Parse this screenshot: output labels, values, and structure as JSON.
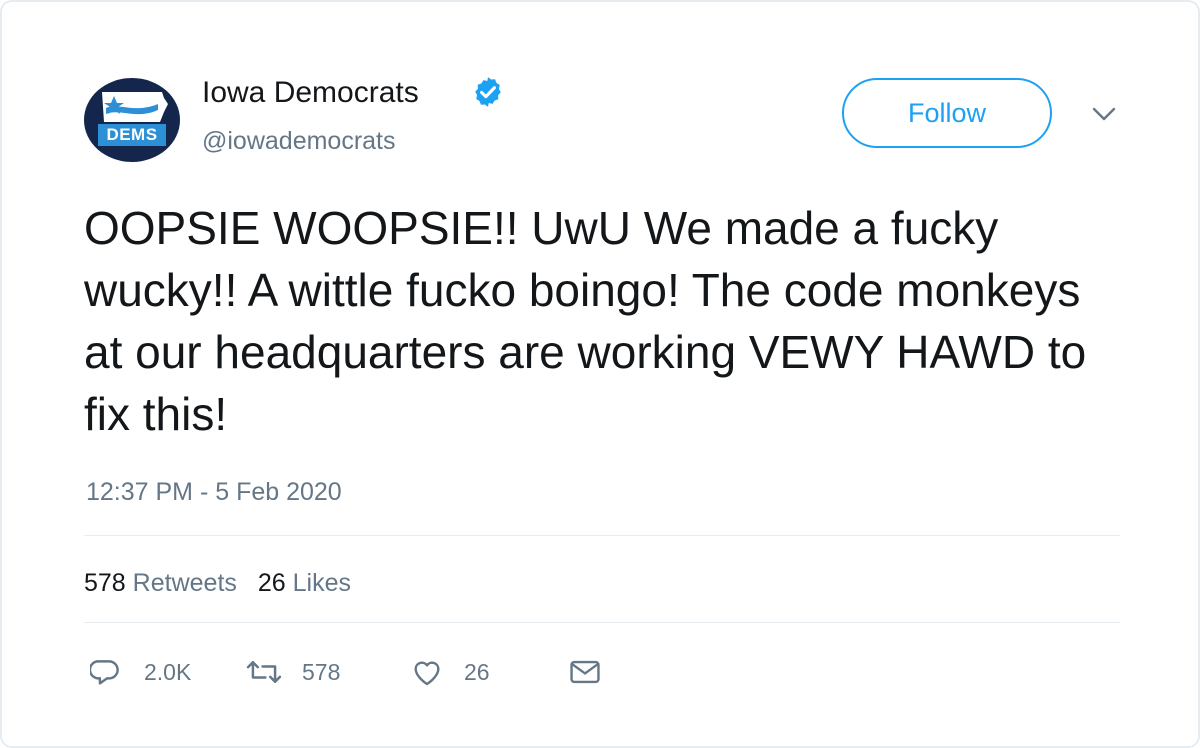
{
  "colors": {
    "accent": "#1da1f2",
    "secondary_text": "#657786",
    "primary_text": "#14171a",
    "avatar_bg": "#15264d",
    "avatar_badge": "#2d8fd5",
    "divider": "#e6ecf0"
  },
  "author": {
    "name": "Iowa Democrats",
    "handle": "@iowademocrats",
    "verified": true,
    "verified_icon": "verified-badge-icon",
    "avatar_badge_text": "DEMS"
  },
  "follow_label": "Follow",
  "menu_icon": "chevron-down-icon",
  "tweet": {
    "text": "OOPSIE WOOPSIE!! UwU We made a fucky wucky!! A wittle fucko boingo! The code monkeys at our headquarters are working VEWY HAWD to fix this!",
    "timestamp": "12:37 PM - 5 Feb 2020"
  },
  "stats": {
    "retweets_count": "578",
    "retweets_label": "Retweets",
    "likes_count": "26",
    "likes_label": "Likes"
  },
  "actions": [
    {
      "icon": "reply-icon",
      "count": "2.0K"
    },
    {
      "icon": "retweet-icon",
      "count": "578"
    },
    {
      "icon": "heart-icon",
      "count": "26"
    },
    {
      "icon": "mail-icon",
      "count": ""
    }
  ]
}
